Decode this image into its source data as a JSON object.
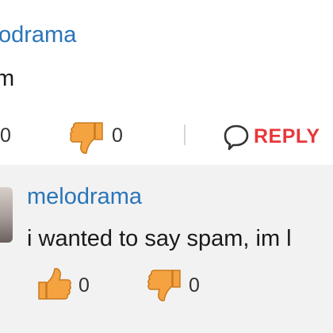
{
  "parent_comment": {
    "author": "odrama",
    "text": "m",
    "upvotes": "0",
    "downvotes": "0",
    "reply_label": "REPLY"
  },
  "reply_comment": {
    "author": "melodrama",
    "text": "i wanted to say spam, im l",
    "upvotes": "0",
    "downvotes": "0"
  },
  "colors": {
    "author_link": "#2a75b8",
    "reply_accent": "#e8373b",
    "thumb_fill": "#f4a340",
    "nested_background": "#f2f2f2"
  },
  "icons": {
    "upvote": "thumbs-up-icon",
    "downvote": "thumbs-down-icon",
    "reply": "speech-bubble-icon"
  }
}
